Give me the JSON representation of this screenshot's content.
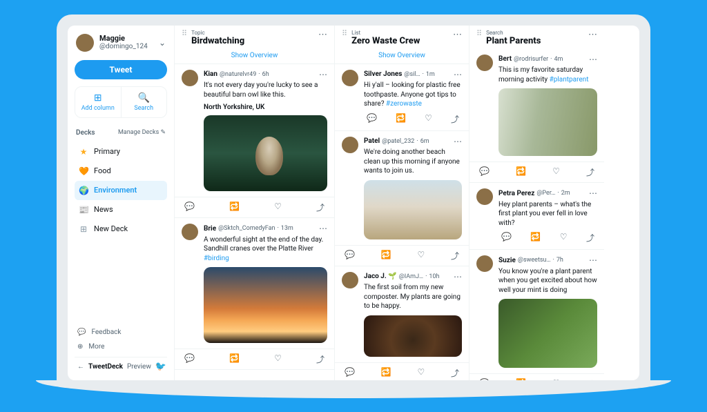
{
  "sidebar": {
    "profile": {
      "name": "Maggie",
      "handle": "@domingo_124"
    },
    "tweet_btn": "Tweet",
    "add_column": "Add column",
    "search": "Search",
    "decks_title": "Decks",
    "manage_decks": "Manage Decks",
    "decks": [
      {
        "icon": "★",
        "color": "#ffad1f",
        "label": "Primary"
      },
      {
        "icon": "🧡",
        "color": "#f4900c",
        "label": "Food"
      },
      {
        "icon": "🌍",
        "color": "#17bf63",
        "label": "Environment",
        "active": true
      },
      {
        "icon": "📰",
        "color": "#8899a6",
        "label": "News"
      },
      {
        "icon": "⊞",
        "color": "#8899a6",
        "label": "New Deck"
      }
    ],
    "feedback": "Feedback",
    "more": "More",
    "preview_label": "TweetDeck",
    "preview_sub": "Preview"
  },
  "columns": [
    {
      "kind": "Topic",
      "title": "Birdwatching",
      "overview": "Show Overview",
      "tweets": [
        {
          "name": "Kian",
          "handle": "@naturelvr49",
          "time": "6h",
          "text": "It's not every day you're lucky to see a beautiful barn owl like this.",
          "sub": "North Yorkshire, UK",
          "media": "owl"
        },
        {
          "name": "Brie",
          "handle": "@Sktch_ComedyFan",
          "time": "13m",
          "text": "A wonderful sight at the end of the day. Sandhill cranes over the Platte River",
          "hashtag": "#birding",
          "media": "birds"
        }
      ]
    },
    {
      "kind": "List",
      "title": "Zero Waste Crew",
      "overview": "Show Overview",
      "tweets": [
        {
          "name": "Silver Jones",
          "handle": "@sil…",
          "time": "1m",
          "text": "Hi y'all – looking for plastic free toothpaste. Anyone got tips to share?",
          "hashtag": "#zerowaste"
        },
        {
          "name": "Patel",
          "handle": "@patel_232",
          "time": "6m",
          "text": "We're doing another beach clean up this morning if anyone wants to join us.",
          "media": "beach"
        },
        {
          "name": "Jaco J. 🌱",
          "handle": "@IAmJ…",
          "time": "10h",
          "text": "The first soil from my new composter. My plants are going to be happy.",
          "media": "compost"
        }
      ]
    },
    {
      "kind": "Search",
      "title": "Plant Parents",
      "tweets": [
        {
          "name": "Bert",
          "handle": "@rodrisurfer",
          "time": "4m",
          "text": "This is my favorite saturday morning activity",
          "hashtag": "#plantparent",
          "media": "balcony"
        },
        {
          "name": "Petra Perez",
          "handle": "@Per…",
          "time": "2m",
          "text": "Hey plant parents – what's the first plant you ever fell in love with?"
        },
        {
          "name": "Suzie",
          "handle": "@sweetsu…",
          "time": "7h",
          "text": "You know you're a plant parent when you get excited about how well your mint is doing",
          "media": "mint"
        }
      ]
    }
  ]
}
